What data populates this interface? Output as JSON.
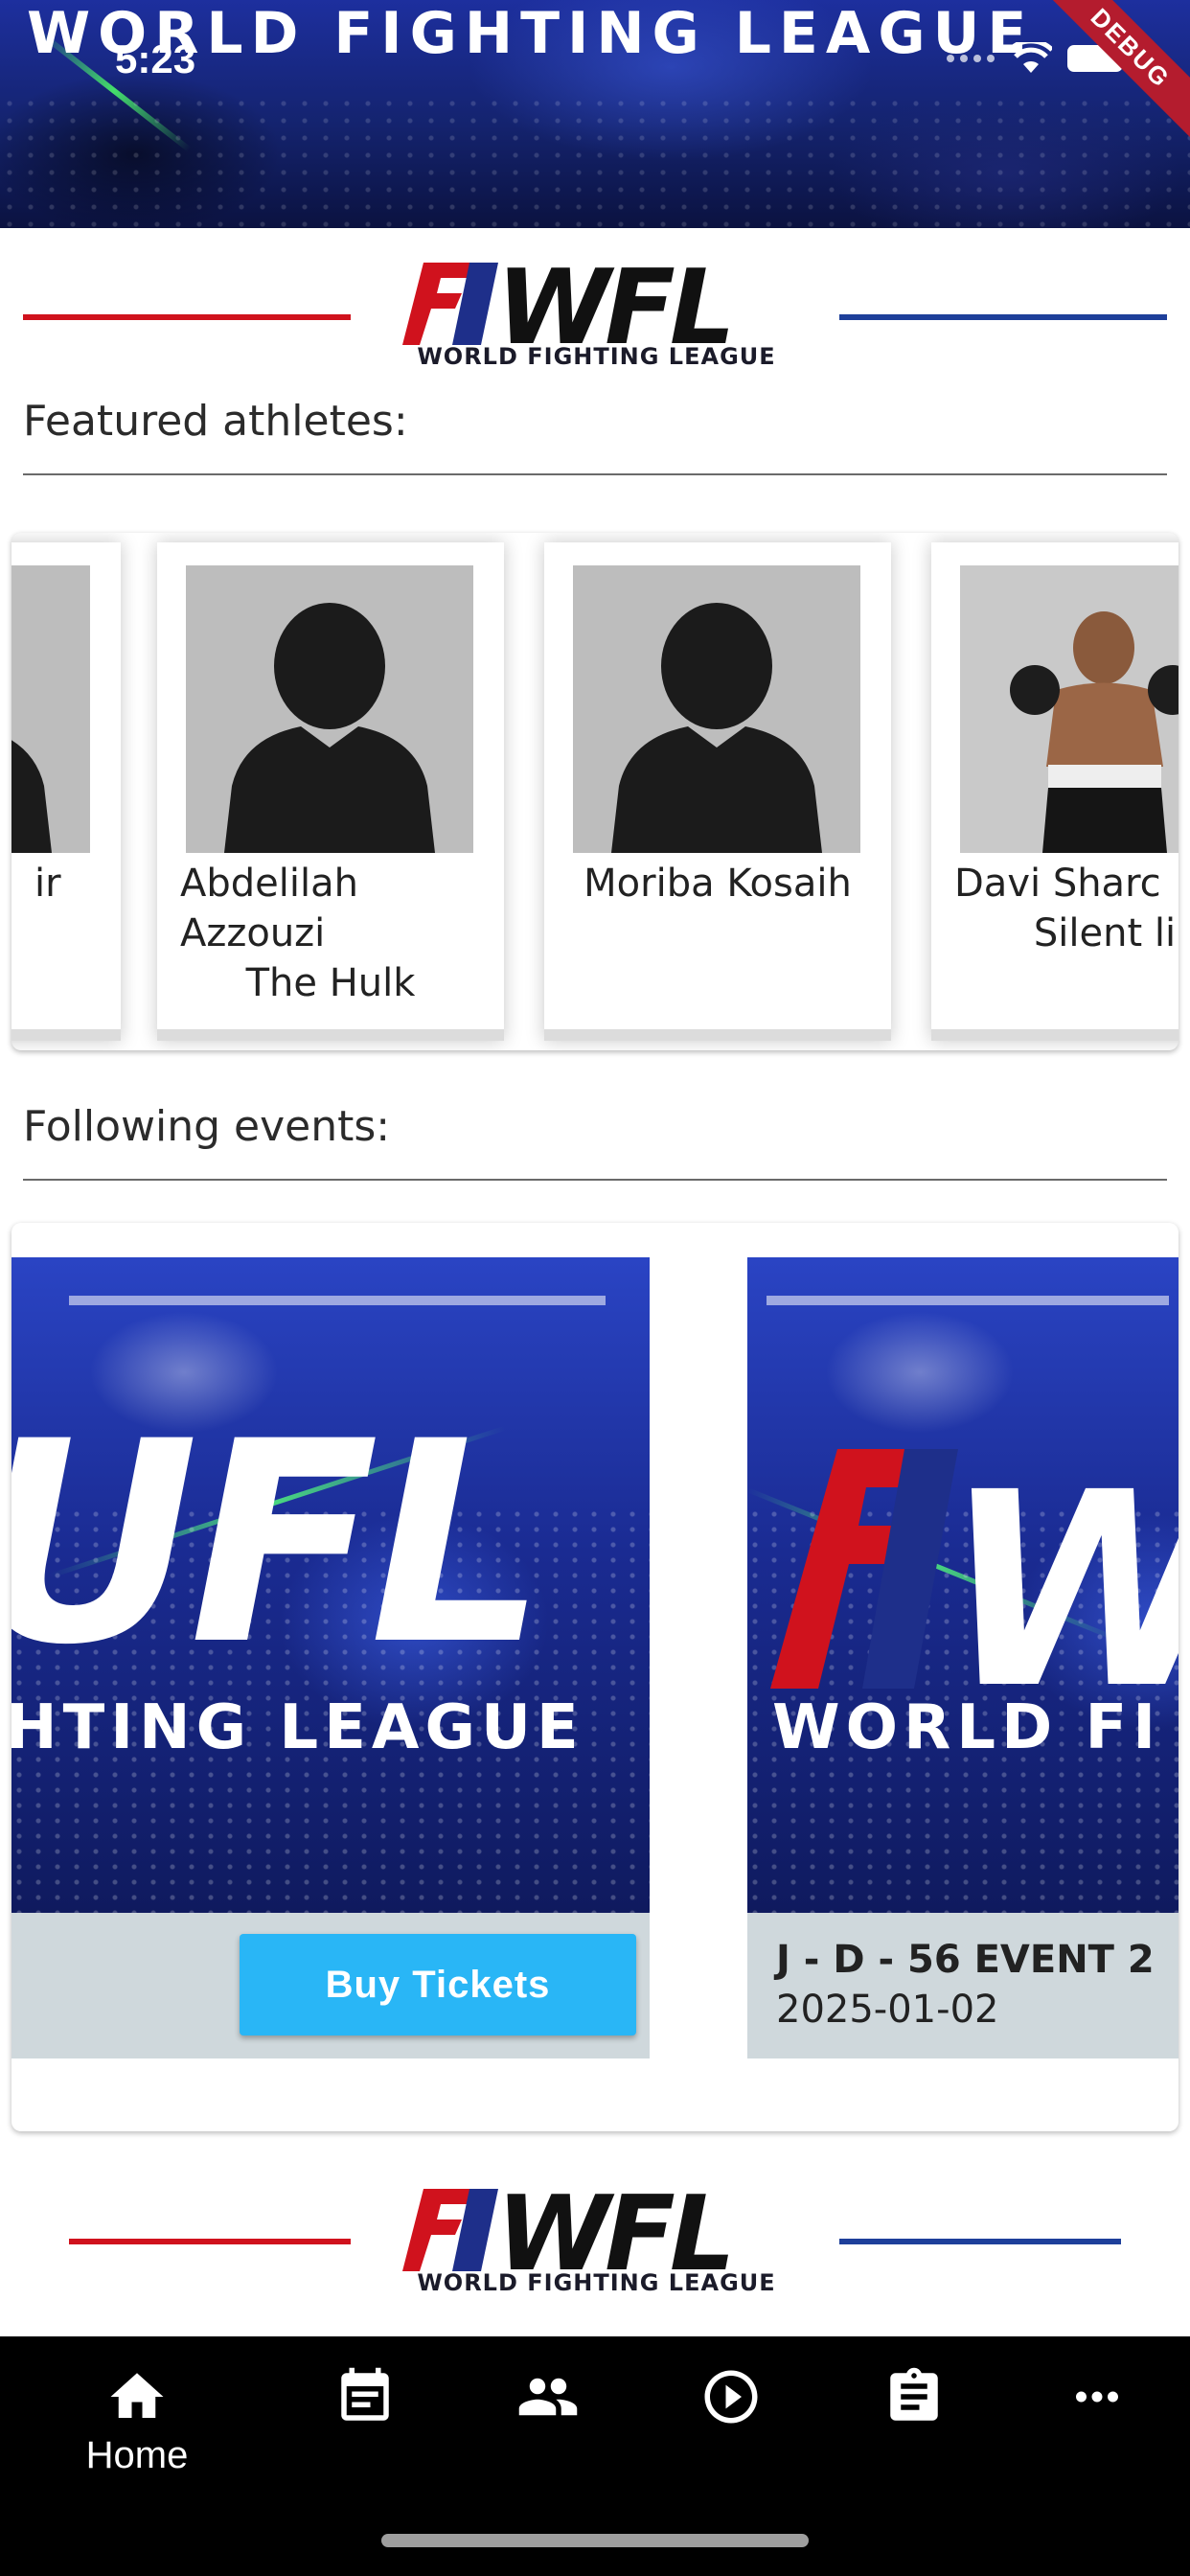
{
  "status_bar": {
    "time": "5:23",
    "debug_label": "DEBUG"
  },
  "hero": {
    "title": "WORLD FIGHTING LEAGUE"
  },
  "logo": {
    "letters": "WFL",
    "subtitle": "WORLD FIGHTING LEAGUE"
  },
  "featured": {
    "heading": "Featured athletes:",
    "athletes": [
      {
        "first": "ir",
        "nick": ""
      },
      {
        "first": "Abdelilah Azzouzi",
        "nick": "The Hulk"
      },
      {
        "first": "Moriba Kosaih",
        "nick": ""
      },
      {
        "first": "Davi Sharc",
        "nick": "Silent li"
      }
    ]
  },
  "events": {
    "heading": "Following events:",
    "items": [
      {
        "poster_letters": "UFL",
        "poster_tag": "HTING LEAGUE",
        "button": "Buy Tickets"
      },
      {
        "poster_letters": "WFL",
        "poster_tag": "WORLD FI",
        "name": "J - D - 56 EVENT 2",
        "date": "2025-01-02"
      }
    ]
  },
  "nav": {
    "items": [
      {
        "icon": "home-icon",
        "label": "Home"
      },
      {
        "icon": "calendar-icon",
        "label": ""
      },
      {
        "icon": "people-icon",
        "label": ""
      },
      {
        "icon": "play-circle-icon",
        "label": ""
      },
      {
        "icon": "clipboard-icon",
        "label": ""
      },
      {
        "icon": "more-horiz-icon",
        "label": ""
      }
    ]
  },
  "colors": {
    "accent_red": "#d0121d",
    "accent_blue": "#1e3f9a",
    "button": "#29b6f6",
    "event_footer": "#cfd8dc"
  }
}
